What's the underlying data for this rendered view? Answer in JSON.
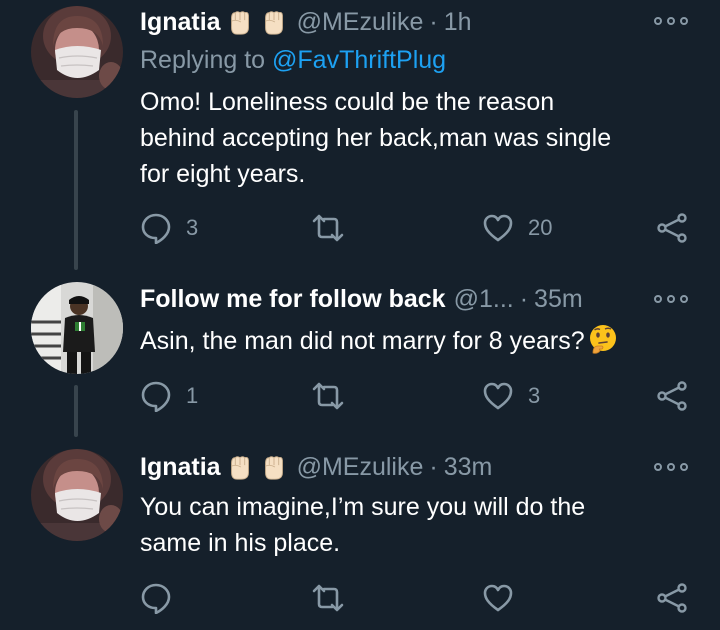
{
  "tweets": [
    {
      "name": "Ignatia",
      "handle": "@MEzulike",
      "dot": "·",
      "time": "1h",
      "reply_prefix": "Replying to ",
      "reply_handle": "@FavThriftPlug",
      "text_lines": [
        "Omo! Loneliness could be the reason",
        "behind accepting her back,man was single",
        "for eight years."
      ],
      "replies": "3",
      "retweets": "",
      "likes": "20"
    },
    {
      "name": "Follow me for follow back",
      "handle": "@1...",
      "dot": "·",
      "time": "35m",
      "text_lines": [
        "Asin, the man did not marry for 8 years?"
      ],
      "replies": "1",
      "retweets": "",
      "likes": "3"
    },
    {
      "name": "Ignatia",
      "handle": "@MEzulike",
      "dot": "·",
      "time": "33m",
      "text_lines": [
        "You can imagine,I’m sure you will do the",
        "same in his place."
      ],
      "replies": "",
      "retweets": "",
      "likes": ""
    }
  ],
  "icons": {
    "reply": "reply-icon",
    "retweet": "retweet-icon",
    "like": "heart-icon",
    "share": "share-icon",
    "more": "more-options-icon",
    "emoji_fist": "raised-fist-emoji",
    "emoji_thinking": "thinking-face-emoji"
  },
  "colors": {
    "background": "#15202b",
    "secondary_text": "#8899a6",
    "link": "#1da1f2",
    "thread_line": "#38444d"
  }
}
